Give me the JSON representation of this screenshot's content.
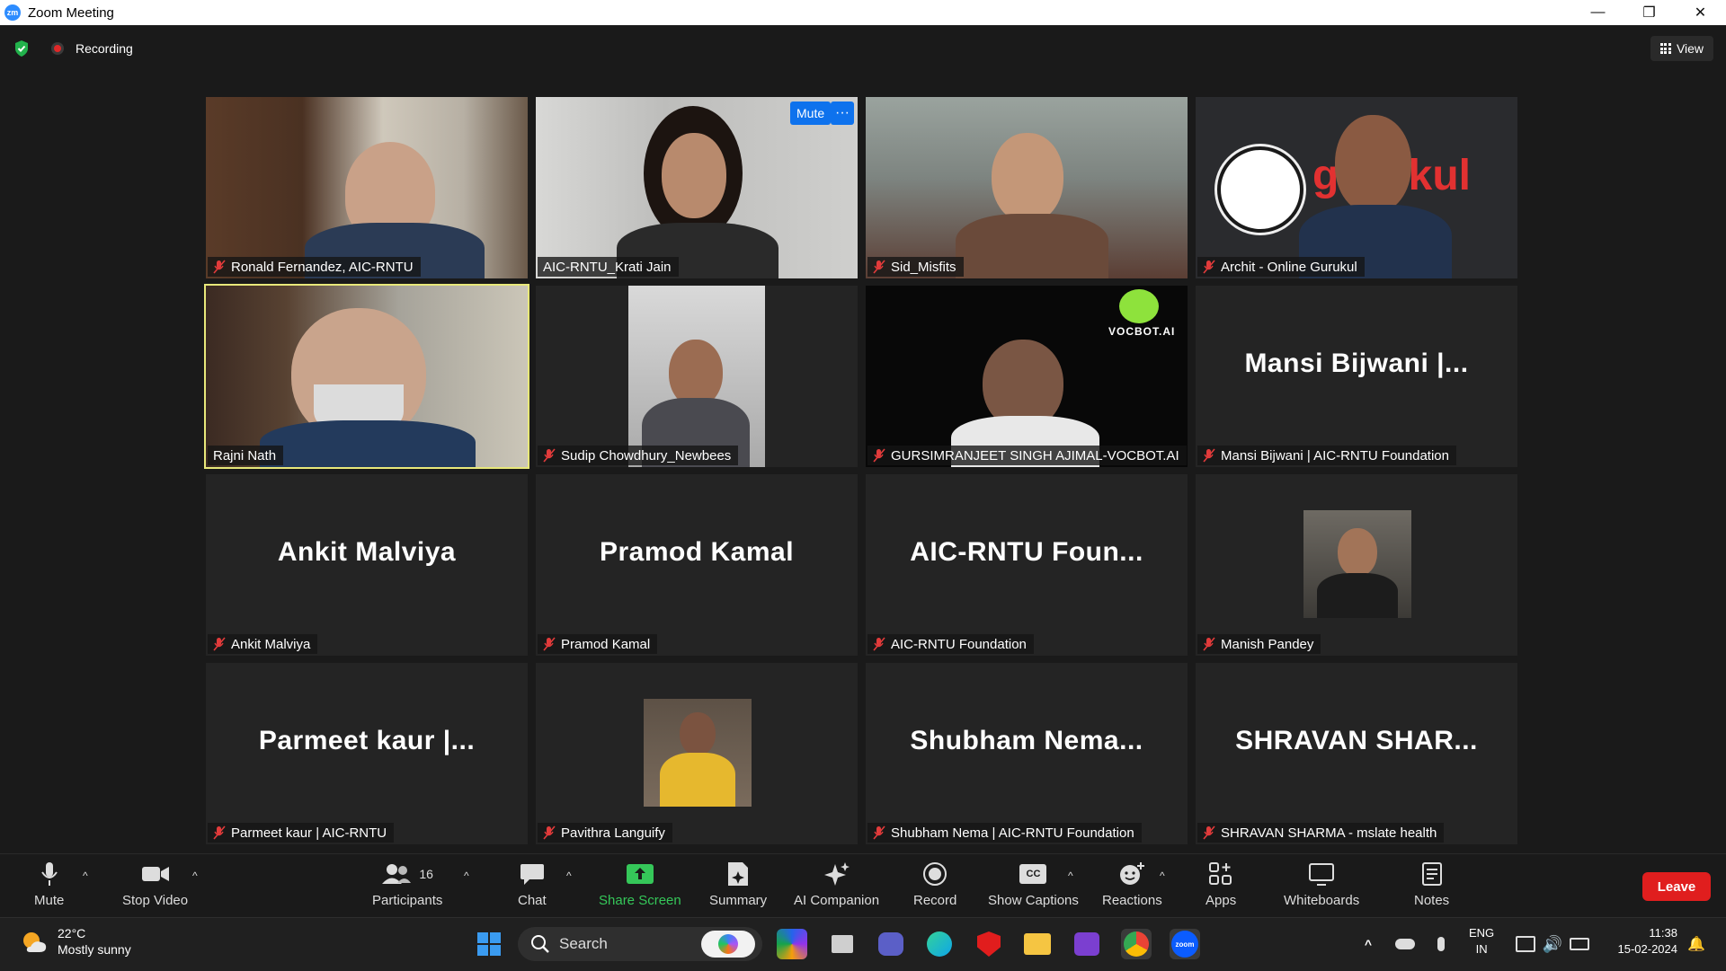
{
  "window": {
    "title": "Zoom Meeting",
    "app_icon_text": "zm"
  },
  "status": {
    "recording_label": "Recording",
    "view_label": "View"
  },
  "tiles": [
    {
      "label": "Ronald Fernandez, AIC-RNTU"
    },
    {
      "label": "AIC-RNTU_Krati Jain",
      "mute_label": "Mute",
      "more_label": "···"
    },
    {
      "label": "Sid_Misfits"
    },
    {
      "label": "Archit - Online Gurukul",
      "logo_text": "gurukul"
    },
    {
      "label": "Rajni Nath"
    },
    {
      "label": "Sudip Chowdhury_Newbees"
    },
    {
      "label": "GURSIMRANJEET SINGH AJIMAL-VOCBOT.AI",
      "logo_text": "VOCBOT.AI"
    },
    {
      "label": "Mansi Bijwani | AIC-RNTU Foundation",
      "display": "Mansi  Bijwani  |..."
    },
    {
      "label": "Ankit Malviya",
      "display": "Ankit Malviya"
    },
    {
      "label": "Pramod Kamal",
      "display": "Pramod Kamal"
    },
    {
      "label": "AIC-RNTU Foundation",
      "display": "AIC-RNTU  Foun..."
    },
    {
      "label": "Manish Pandey"
    },
    {
      "label": "Parmeet kaur | AIC-RNTU",
      "display": "Parmeet  kaur  |..."
    },
    {
      "label": "Pavithra Languify"
    },
    {
      "label": "Shubham Nema | AIC-RNTU Foundation",
      "display": "Shubham  Nema..."
    },
    {
      "label": "SHRAVAN SHARMA - mslate health",
      "display": "SHRAVAN  SHAR..."
    }
  ],
  "toolbar": {
    "mute": "Mute",
    "stop_video": "Stop Video",
    "participants": "Participants",
    "participants_count": "16",
    "chat": "Chat",
    "share_screen": "Share Screen",
    "summary": "Summary",
    "ai_companion": "AI Companion",
    "record": "Record",
    "show_captions": "Show Captions",
    "captions_icon_text": "CC",
    "reactions": "Reactions",
    "apps": "Apps",
    "whiteboards": "Whiteboards",
    "notes": "Notes",
    "leave": "Leave"
  },
  "taskbar": {
    "temperature": "22°C",
    "weather": "Mostly sunny",
    "search": "Search",
    "language": "ENG",
    "region": "IN",
    "time": "11:38",
    "date": "15-02-2024",
    "zoom_icon_text": "zoom"
  },
  "colors": {
    "accent": "#0e72ed",
    "active_speaker": "#e8e87a",
    "leave": "#e01e1e",
    "share": "#35c759"
  }
}
